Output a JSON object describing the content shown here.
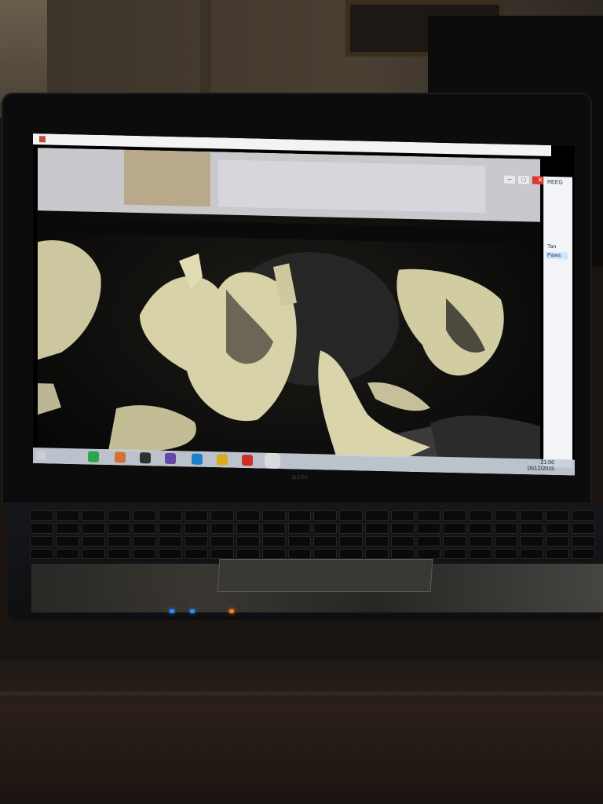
{
  "scene": {
    "description_kind": "photo of laptop screen",
    "colors": {
      "screen_bg": "#000000",
      "taskbar": "#c8cfd8",
      "close_button": "#e0352c"
    }
  },
  "window": {
    "minimize_glyph": "–",
    "maximize_glyph": "□",
    "close_glyph": "✕"
  },
  "right_pane": {
    "lines": [
      "REEG",
      "Tan",
      "Paws"
    ]
  },
  "taskbar": {
    "apps": [
      {
        "icon": "store-icon",
        "color": "#2fb153"
      },
      {
        "icon": "camera-icon",
        "color": "#e07a3a"
      },
      {
        "icon": "webcam-icon",
        "color": "#333333"
      },
      {
        "icon": "media-icon",
        "color": "#6a4fb0"
      },
      {
        "icon": "app-icon",
        "color": "#1e88d8"
      },
      {
        "icon": "chrome-icon",
        "color": "#e8b51f"
      },
      {
        "icon": "power-icon",
        "color": "#d8312a"
      },
      {
        "icon": "photos-icon",
        "color": "#e8e8e8"
      }
    ],
    "time": "21:06",
    "date": "16/12/2015"
  },
  "laptop": {
    "brand": "acer"
  }
}
